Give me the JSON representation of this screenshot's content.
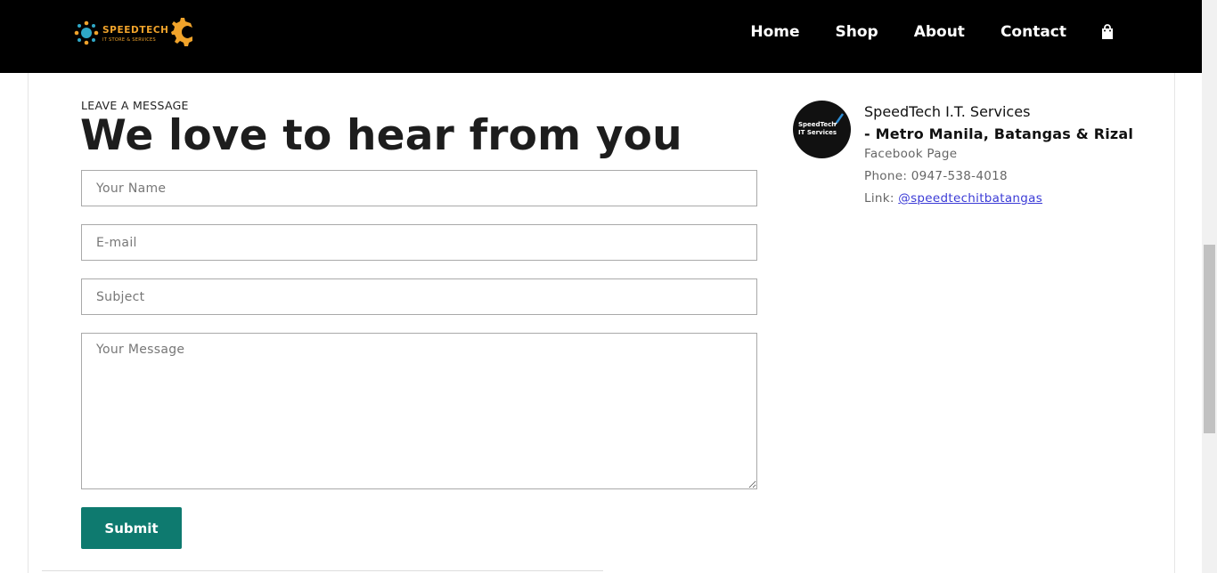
{
  "header": {
    "logo_text": "SPEEDTECH",
    "logo_subtext": "IT STORE & SERVICES",
    "nav": [
      {
        "label": "Home"
      },
      {
        "label": "Shop"
      },
      {
        "label": "About"
      },
      {
        "label": "Contact"
      }
    ],
    "cart_icon": "shopping-bag-icon"
  },
  "form": {
    "eyebrow": "LEAVE A MESSAGE",
    "headline": "We love to hear from you",
    "name_placeholder": "Your Name",
    "email_placeholder": "E-mail",
    "subject_placeholder": "Subject",
    "message_placeholder": "Your Message",
    "submit_label": "Submit"
  },
  "contact_info": {
    "avatar_text_1": "SpeedTech",
    "avatar_text_2": "IT Services",
    "title_line_1": "SpeedTech I.T. Services",
    "title_line_2": "- Metro Manila, Batangas & Rizal",
    "facebook_label": "Facebook Page",
    "phone_label": "Phone: 0947-538-4018",
    "link_prefix": "Link: ",
    "link_text": "@speedtechitbatangas"
  },
  "colors": {
    "header_bg": "#000000",
    "accent": "#0e7a6f",
    "logo_orange": "#f0a32b",
    "link": "#3b3bd6"
  }
}
